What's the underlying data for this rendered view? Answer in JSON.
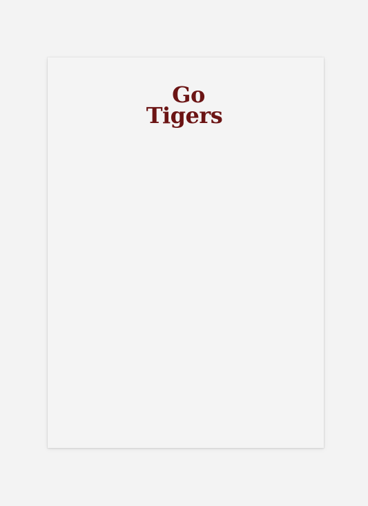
{
  "notepad": {
    "logo": {
      "line1": "Go",
      "line2": "Tigers"
    }
  },
  "colors": {
    "background": "#f3f3f3",
    "paper": "#f4f4f4",
    "ink": "#6b1414"
  }
}
